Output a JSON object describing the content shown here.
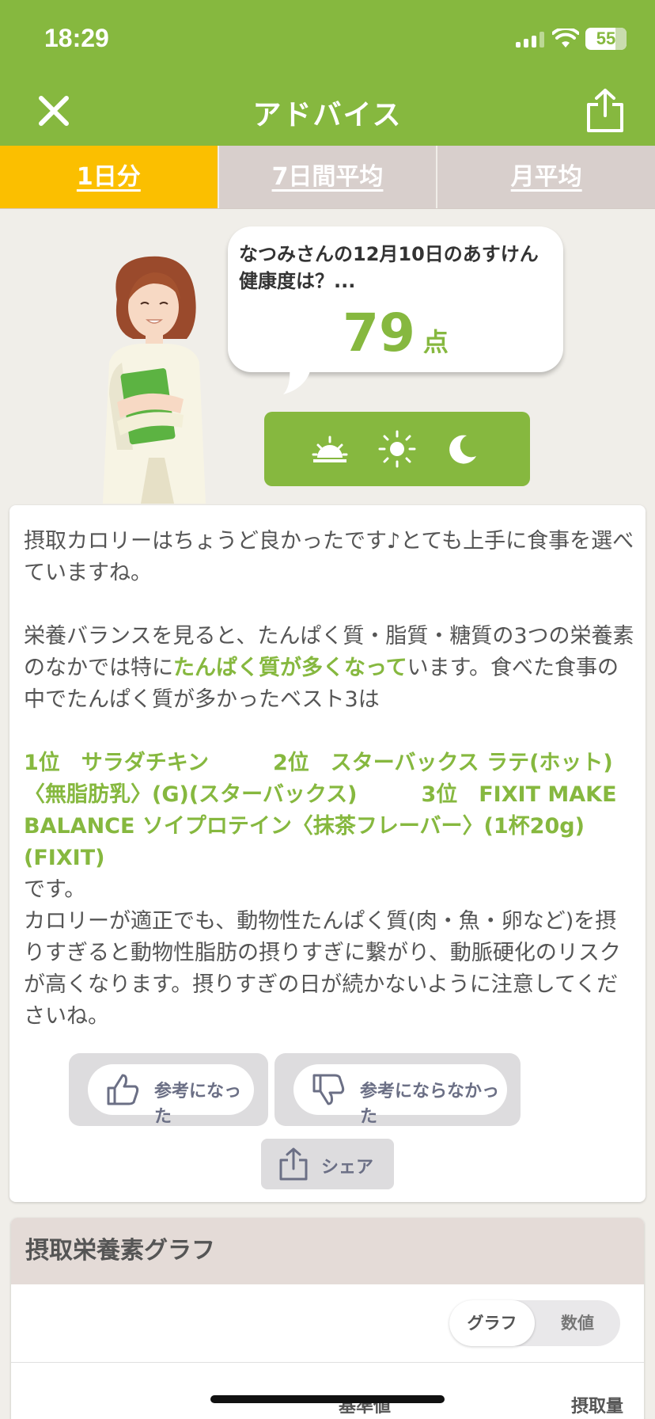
{
  "status_bar": {
    "time": "18:29",
    "battery": "55"
  },
  "nav": {
    "title": "アドバイス"
  },
  "tabs": [
    {
      "label": "1日分",
      "active": true
    },
    {
      "label": "7日間平均",
      "active": false
    },
    {
      "label": "月平均",
      "active": false
    }
  ],
  "bubble": {
    "text": "なつみさんの12月10日のあすけん健康度は？...",
    "score": "79",
    "unit": "点"
  },
  "time_icons": [
    "sunrise-icon",
    "sun-icon",
    "moon-icon"
  ],
  "advice": {
    "p1": "摂取カロリーはちょうど良かったです♪とても上手に食事を選べていますね。",
    "p2_pre": "栄養バランスを見ると、たんぱく質・脂質・糖質の3つの栄養素のなかでは特に",
    "p2_highlight": "たんぱく質が多くなって",
    "p2_post": "います。食べた食事の中でたんぱく質が多かったベスト3は",
    "best3": "1位　サラダチキン　　　2位　スターバックス ラテ(ホット)〈無脂肪乳〉(G)(スターバックス)　　　3位　FIXIT MAKE BALANCE ソイプロテイン〈抹茶フレーバー〉(1杯20g)(FIXIT)",
    "desu": "です。",
    "p3": "カロリーが適正でも、動物性たんぱく質(肉・魚・卵など)を摂りすぎると動物性脂肪の摂りすぎに繋がり、動脈硬化のリスクが高くなります。摂りすぎの日が続かないように注意してくださいね。"
  },
  "feedback": {
    "helpful": "参考になった",
    "not_helpful": "参考にならなかった",
    "share": "シェア"
  },
  "graph": {
    "title": "摂取栄養素グラフ",
    "toggle_on": "グラフ",
    "toggle_off": "数値",
    "col_standard": "基準値",
    "col_intake": "摂取量"
  },
  "colors": {
    "accent_green": "#86b83f",
    "tab_active": "#fbbf00",
    "tab_inactive": "#d8cfcc"
  }
}
